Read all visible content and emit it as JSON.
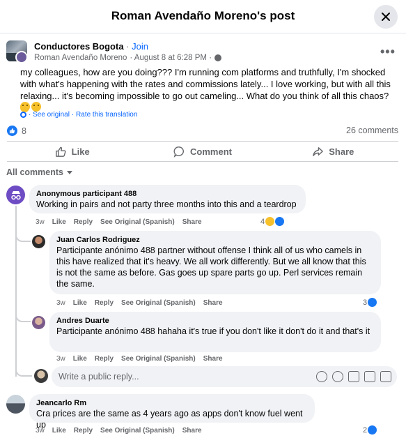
{
  "header": {
    "title": "Roman Avendaño Moreno's post"
  },
  "post": {
    "group_name": "Conductores Bogota",
    "separator": " · ",
    "join_label": "Join",
    "author": "Roman Avendaño Moreno",
    "date": "· August 8 at 6:28 PM ·",
    "body": "my colleagues, how are you doing??? I'm running com platforms and truthfully, I'm shocked with what's happening with the rates and commissions lately... I love working, but with all this relaxing... it's becoming impossible to go out cameling... What do you think of all this chaos?",
    "see_original": "· See original",
    "rate_translation": "· Rate this translation",
    "like_count": "8",
    "comments_count": "26 comments"
  },
  "actions": {
    "like": "Like",
    "comment": "Comment",
    "share": "Share"
  },
  "filter": {
    "label": "All comments"
  },
  "comments": [
    {
      "name": "Anonymous participant 488",
      "text": "Working in pairs and not party three months into this and a teardrop",
      "time": "3w",
      "like": "Like",
      "reply": "Reply",
      "see_original": "See Original (Spanish)",
      "share": "Share",
      "reactions": "4"
    },
    {
      "name": "Juan Carlos Rodriguez",
      "text": "Participante anónimo 488 partner without offense I think all of us who camels in this have realized that it's heavy. We all work differently. But we all know that this is not the same as before. Gas goes up spare parts go up. Perl services remain the same.",
      "time": "3w",
      "like": "Like",
      "reply": "Reply",
      "see_original": "See Original (Spanish)",
      "share": "Share",
      "reactions": "3"
    },
    {
      "name": "Andres Duarte",
      "text": "Participante anónimo 488 hahaha it's true if you don't like it don't do it and that's it",
      "time": "3w",
      "like": "Like",
      "reply": "Reply",
      "see_original": "See Original (Spanish)",
      "share": "Share"
    },
    {
      "name": "Jeancarlo Rm",
      "text": "Cra prices are the same as 4 years ago as apps don't know fuel went up",
      "time": "3w",
      "like": "Like",
      "reply": "Reply",
      "see_original": "See Original (Spanish)",
      "share": "Share",
      "reactions": "2"
    }
  ],
  "reply_box": {
    "placeholder": "Write a public reply..."
  },
  "colors": {
    "accent": "#0866ff",
    "like_blue": "#1877f2",
    "bubble": "#f0f2f5",
    "muted": "#65676b"
  }
}
